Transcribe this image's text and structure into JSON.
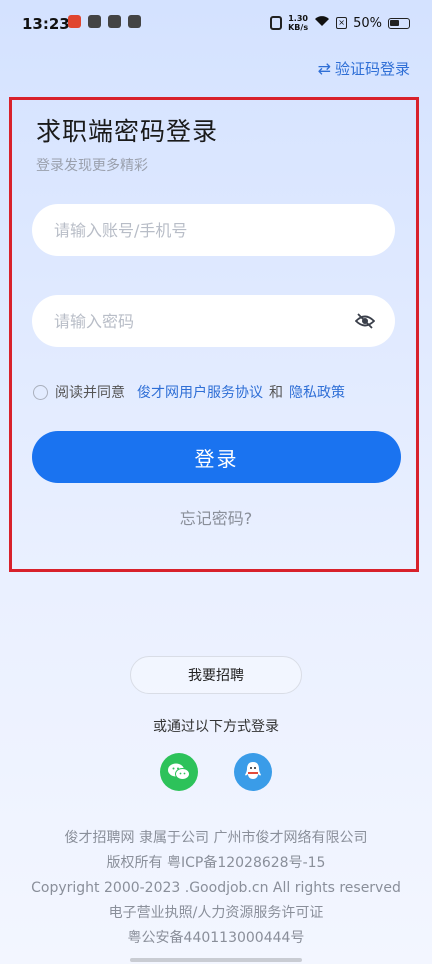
{
  "status_bar": {
    "time": "13:23",
    "speed_top": "1.30",
    "speed_bottom": "KB/s",
    "battery": "50%"
  },
  "switch_link": {
    "label": "验证码登录",
    "icon": "swap-icon"
  },
  "header": {
    "title": "求职端密码登录",
    "subtitle": "登录发现更多精彩"
  },
  "form": {
    "account_placeholder": "请输入账号/手机号",
    "password_placeholder": "请输入密码"
  },
  "agreement": {
    "prefix": "阅读并同意",
    "terms": "俊才网用户服务协议",
    "and": "和",
    "privacy": "隐私政策"
  },
  "login_button": "登录",
  "forgot": "忘记密码?",
  "recruit_button": "我要招聘",
  "other_login": "或通过以下方式登录",
  "social": [
    {
      "name": "wechat-icon",
      "color": "#2dc25a"
    },
    {
      "name": "qq-icon",
      "color": "#3a9ce8"
    }
  ],
  "footer": {
    "line1": "俊才招聘网 隶属于公司 广州市俊才网络有限公司",
    "line2": "版权所有 粤ICP备12028628号-15",
    "line3": "Copyright 2000-2023 .Goodjob.cn All rights reserved",
    "line4": "电子营业执照/人力资源服务许可证",
    "line5": "粤公安备440113000444号"
  },
  "colors": {
    "accent": "#1a73f0",
    "link": "#2f6fd6",
    "highlight_frame": "#d8212b"
  }
}
